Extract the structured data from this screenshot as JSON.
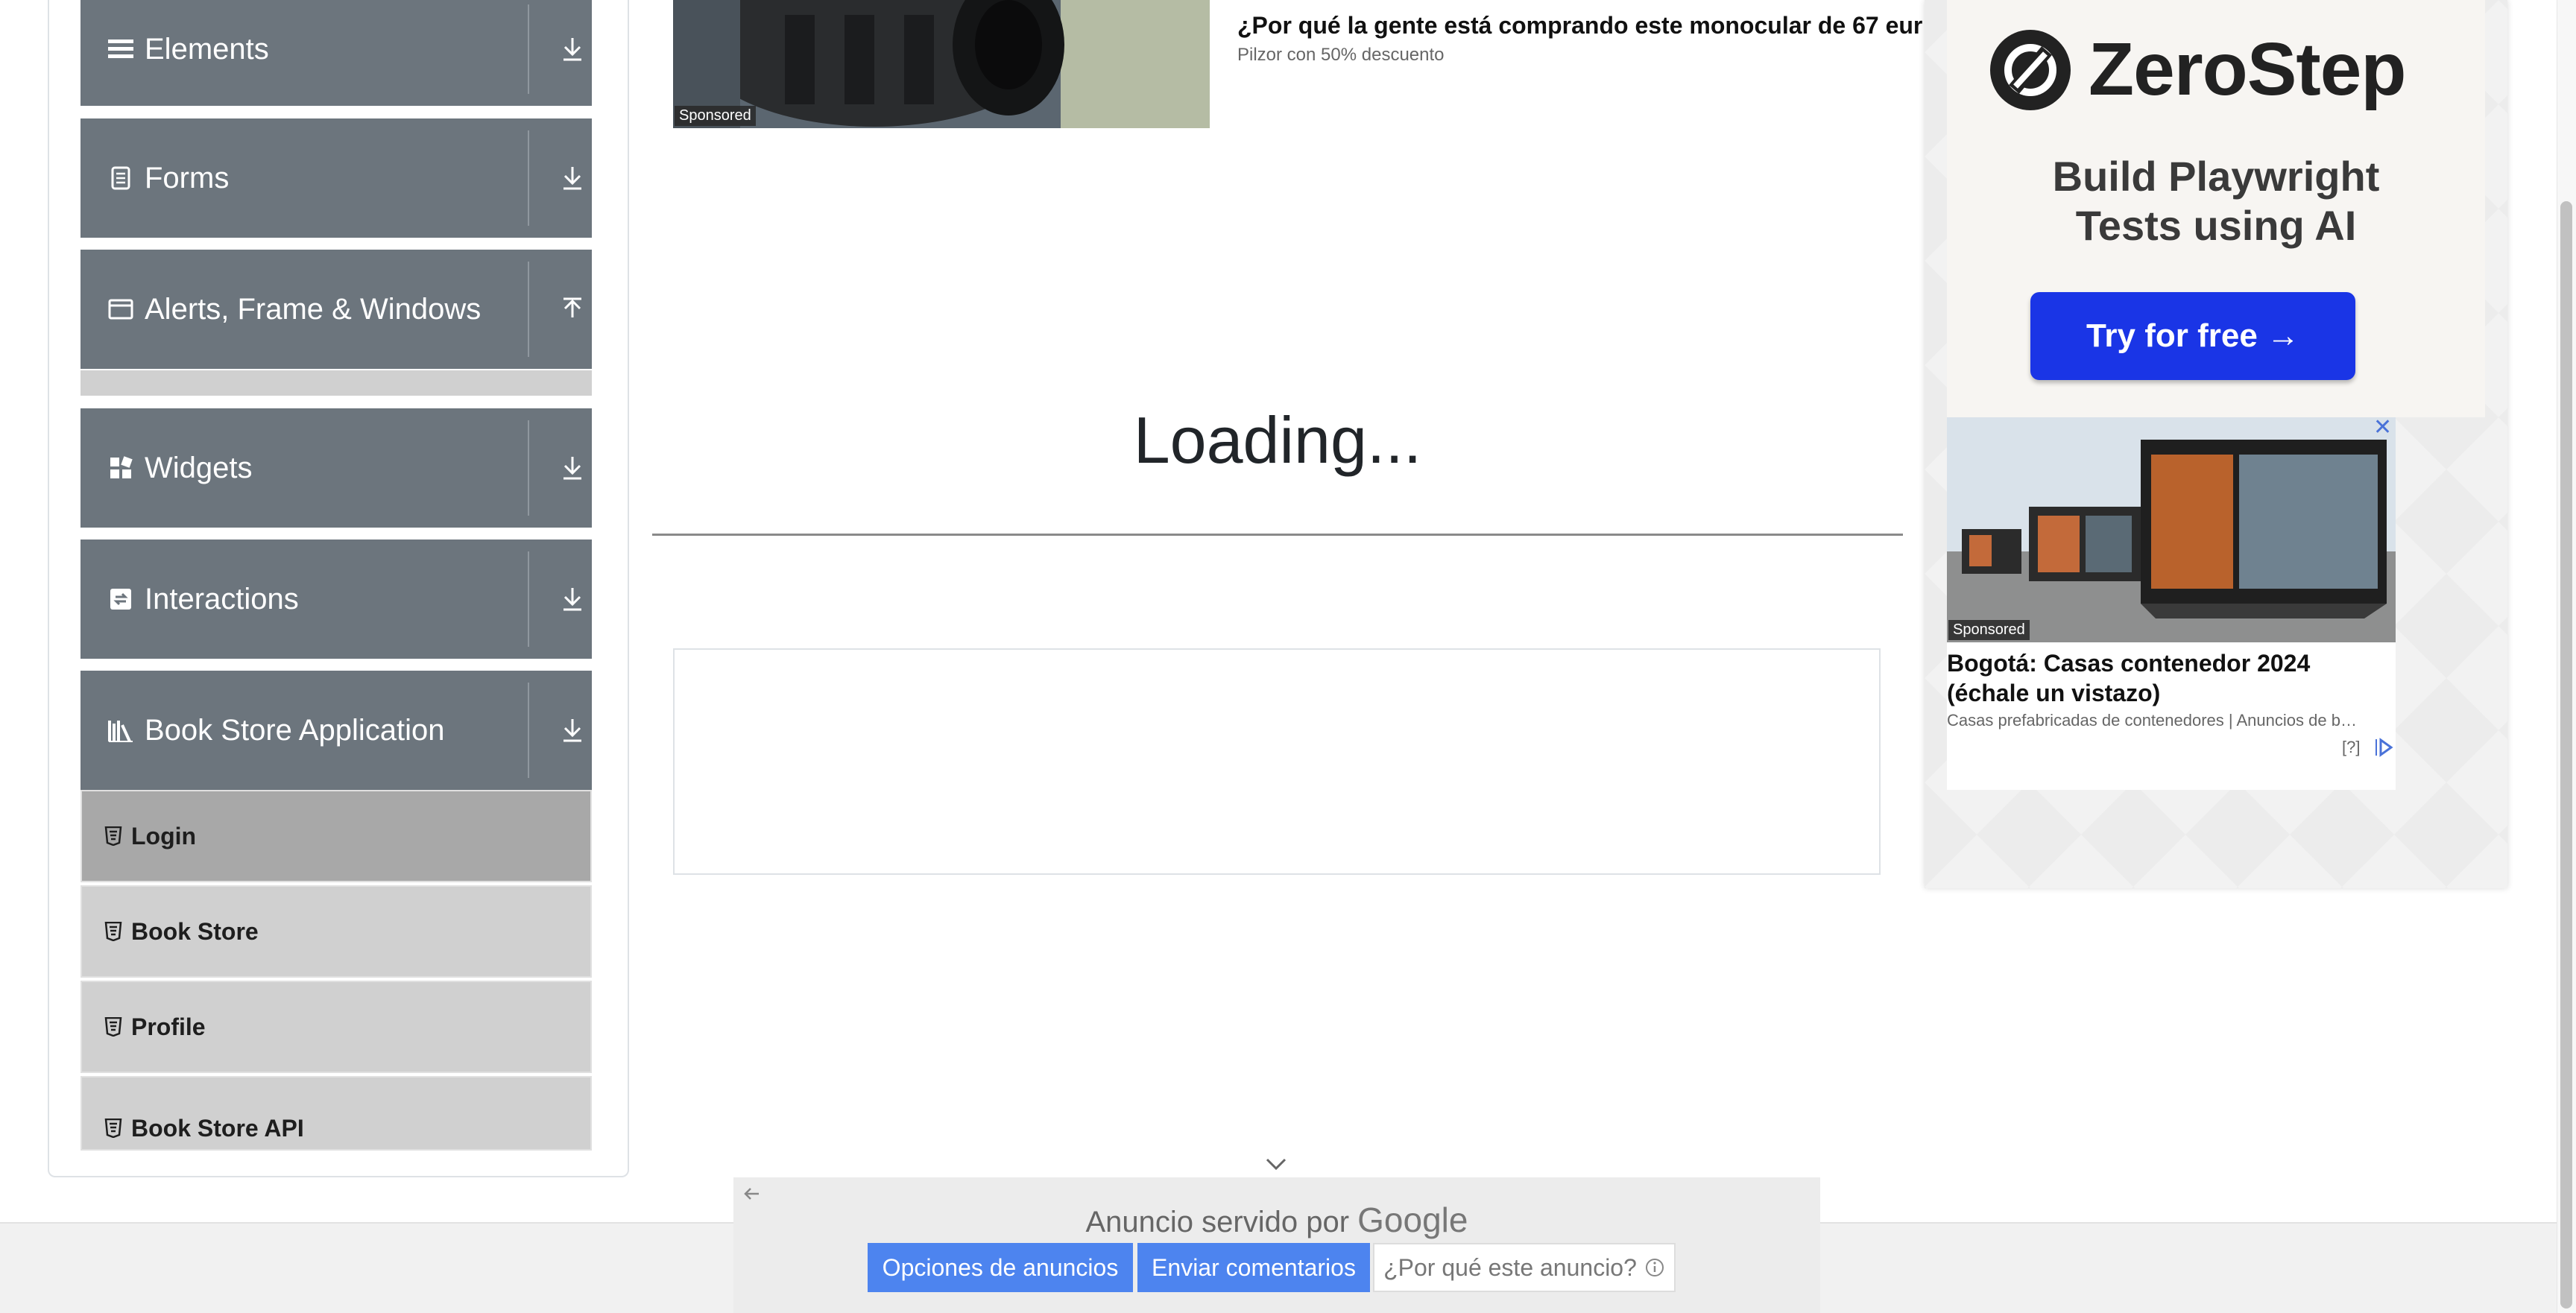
{
  "sidebar": {
    "groups": [
      {
        "label": "Elements",
        "icon": "hamburger-icon",
        "arrow": "download-arrow-icon"
      },
      {
        "label": "Forms",
        "icon": "document-icon",
        "arrow": "download-arrow-icon"
      },
      {
        "label": "Alerts, Frame & Windows",
        "icon": "window-icon",
        "arrow": "upload-arrow-icon"
      },
      {
        "label": "Widgets",
        "icon": "widgets-icon",
        "arrow": "download-arrow-icon"
      },
      {
        "label": "Interactions",
        "icon": "interactions-icon",
        "arrow": "download-arrow-icon"
      },
      {
        "label": "Book Store Application",
        "icon": "books-icon",
        "arrow": "download-arrow-icon"
      }
    ],
    "items": [
      {
        "label": "Login",
        "active": true
      },
      {
        "label": "Book Store",
        "active": false
      },
      {
        "label": "Profile",
        "active": false
      },
      {
        "label": "Book Store API",
        "active": false
      }
    ]
  },
  "top_ad": {
    "sponsored": "Sponsored",
    "title": "¿Por qué la gente está comprando este monocular de 67 eur",
    "subtitle": "Pilzor con 50% descuento"
  },
  "main": {
    "loading": "Loading..."
  },
  "right_ad": {
    "brand": "ZeroStep",
    "tagline_line1": "Build Playwright",
    "tagline_line2": "Tests using AI",
    "cta": "Try for free →",
    "card": {
      "sponsored": "Sponsored",
      "title": "Bogotá: Casas contenedor 2024 (échale un vistazo)",
      "subtitle": "Casas prefabricadas de contenedores | Anuncios de b…",
      "help": "[?]"
    }
  },
  "ad_bar": {
    "served_by": "Anuncio servido por",
    "google": "Google",
    "options": "Opciones de anuncios",
    "feedback": "Enviar comentarios",
    "why": "¿Por qué este anuncio?"
  },
  "colors": {
    "header_bg": "#6c757d",
    "item_bg": "#d0d0d0",
    "item_active_bg": "#a8a8a8",
    "cta_blue": "#1a35e6",
    "google_btn_blue": "#4d84ef"
  }
}
